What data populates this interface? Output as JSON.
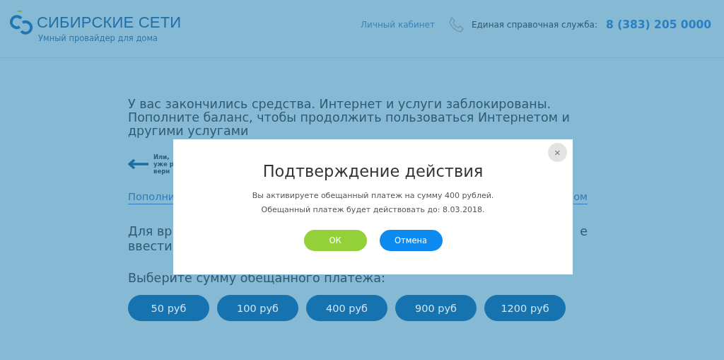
{
  "header": {
    "logo_title": "СИБИРСКИЕ СЕТИ",
    "logo_subtitle": "Умный провайдер для дома",
    "account_link": "Личный кабинет",
    "support_label": "Единая справочная служба:",
    "support_phone": "8 (383) 205 0000"
  },
  "notice": {
    "lines": [
      "У вас закончились средства. Интернет и услуги заблокированы.",
      "Пополните баланс, чтобы продолжить пользоваться Интернетом и",
      "другими услугами"
    ]
  },
  "back_hint": {
    "lines": [
      "Или,",
      "уже р",
      "верн"
    ]
  },
  "topup_link": {
    "left": "Пополни",
    "right": "ом"
  },
  "promise_text": {
    "left_lines": [
      "Для вр",
      "ввести"
    ],
    "right_lines": [
      "е"
    ]
  },
  "amount_prompt": "Выберите сумму обещанного платежа:",
  "amounts": [
    {
      "label": "50 руб"
    },
    {
      "label": "100 руб"
    },
    {
      "label": "400 руб"
    },
    {
      "label": "900 руб"
    },
    {
      "label": "1200 руб"
    }
  ],
  "dialog": {
    "title": "Подтверждение действия",
    "message_lines": [
      "Вы активируете обещанный платеж на сумму 400 рублей.",
      "Обещанный платеж будет действовать до: 8.03.2018."
    ],
    "buttons": [
      {
        "label": "ОК",
        "kind": "confirm"
      },
      {
        "label": "Отмена",
        "kind": "cancel"
      }
    ],
    "close": "×"
  }
}
